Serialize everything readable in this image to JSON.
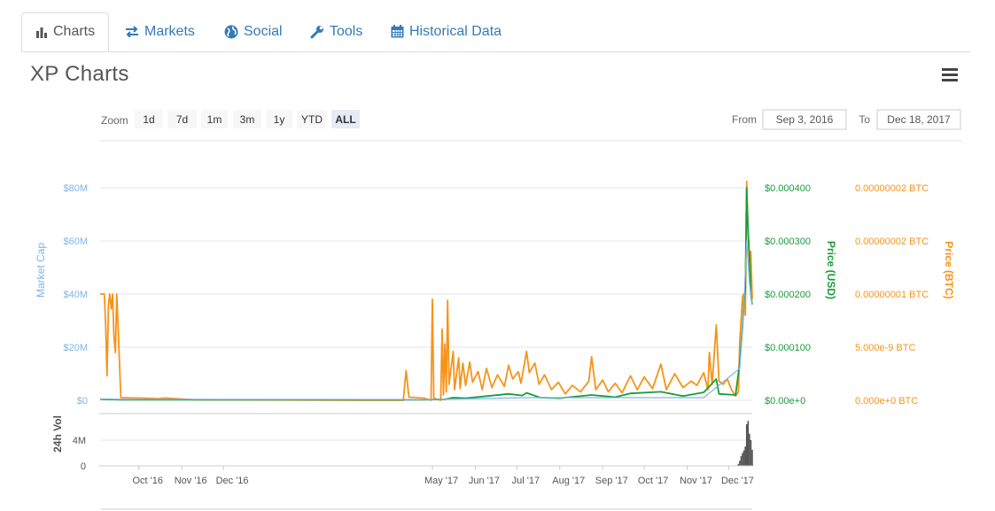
{
  "tabs": [
    {
      "label": "Charts",
      "icon": "bar-chart-icon",
      "active": true
    },
    {
      "label": "Markets",
      "icon": "exchange-arrows-icon",
      "active": false
    },
    {
      "label": "Social",
      "icon": "globe-icon",
      "active": false
    },
    {
      "label": "Tools",
      "icon": "wrench-icon",
      "active": false
    },
    {
      "label": "Historical Data",
      "icon": "calendar-icon",
      "active": false
    }
  ],
  "page_title": "XP Charts",
  "menu_icon": "hamburger-menu-icon",
  "zoom": {
    "label": "Zoom",
    "buttons": [
      "1d",
      "7d",
      "1m",
      "3m",
      "1y",
      "YTD",
      "ALL"
    ],
    "selected": "ALL"
  },
  "range": {
    "from_label": "From",
    "from_value": "Sep 3, 2016",
    "to_label": "To",
    "to_value": "Dec 18, 2017"
  },
  "colors": {
    "market_cap": "#7cb5ec",
    "price_usd": "#1a9c3a",
    "price_btc": "#f7931a",
    "volume": "#555555",
    "accent": "#337ab7",
    "grid": "#e6e6e6"
  },
  "chart_data": {
    "type": "line",
    "x_axis": {
      "min": "2016-09-03",
      "max": "2017-12-18",
      "ticks": [
        "Oct '16",
        "Nov '16",
        "Dec '16",
        "May '17",
        "Jun '17",
        "Jul '17",
        "Aug '17",
        "Sep '17",
        "Oct '17",
        "Nov '17",
        "Dec '17"
      ]
    },
    "grid": true,
    "axes": {
      "market_cap": {
        "label": "Market Cap",
        "ticks": [
          "$0",
          "$20M",
          "$40M",
          "$60M",
          "$80M"
        ],
        "range": [
          0,
          80000000
        ]
      },
      "price_usd": {
        "label": "Price (USD)",
        "ticks": [
          "$0.00e+0",
          "$0.000100",
          "$0.000200",
          "$0.000300",
          "$0.000400"
        ],
        "range": [
          0,
          0.0004
        ]
      },
      "price_btc": {
        "label": "Price (BTC)",
        "ticks": [
          "0.000e+0 BTC",
          "5.000e-9 BTC",
          "0.00000001 BTC",
          "0.00000002 BTC",
          "0.00000002 BTC"
        ],
        "range": [
          0,
          2e-08
        ]
      },
      "volume": {
        "label": "24h Vol",
        "ticks": [
          "0",
          "4M"
        ],
        "range": [
          0,
          8000000
        ]
      }
    },
    "series": [
      {
        "name": "Price (BTC)",
        "axis": "price_btc",
        "points": [
          [
            "2016-09-03",
            1e-08
          ],
          [
            "2016-09-06",
            1e-08
          ],
          [
            "2016-09-07",
            7e-09
          ],
          [
            "2016-09-08",
            2.3e-09
          ],
          [
            "2016-09-09",
            9e-09
          ],
          [
            "2016-09-10",
            1e-08
          ],
          [
            "2016-09-11",
            8.6e-09
          ],
          [
            "2016-09-12",
            1e-08
          ],
          [
            "2016-09-13",
            6e-09
          ],
          [
            "2016-09-14",
            4.5e-09
          ],
          [
            "2016-09-15",
            1e-08
          ],
          [
            "2016-09-18",
            2.5e-10
          ],
          [
            "2016-10-06",
            2e-10
          ],
          [
            "2016-10-15",
            1.5e-10
          ],
          [
            "2016-10-20",
            2.2e-10
          ],
          [
            "2016-11-10",
            5e-11
          ],
          [
            "2017-03-20",
            0
          ],
          [
            "2017-04-10",
            0
          ],
          [
            "2017-04-12",
            2.8e-09
          ],
          [
            "2017-04-14",
            3e-10
          ],
          [
            "2017-04-25",
            2e-10
          ],
          [
            "2017-04-30",
            0
          ],
          [
            "2017-05-01",
            9.5e-09
          ],
          [
            "2017-05-02",
            2e-10
          ],
          [
            "2017-05-07",
            0
          ],
          [
            "2017-05-08",
            6.7e-09
          ],
          [
            "2017-05-09",
            5e-10
          ],
          [
            "2017-05-10",
            5.3e-09
          ],
          [
            "2017-05-11",
            8e-10
          ],
          [
            "2017-05-12",
            9.4e-09
          ],
          [
            "2017-05-13",
            1.5e-09
          ],
          [
            "2017-05-16",
            4.6e-09
          ],
          [
            "2017-05-17",
            1e-09
          ],
          [
            "2017-05-20",
            4e-09
          ],
          [
            "2017-05-21",
            1.1e-09
          ],
          [
            "2017-05-23",
            3.5e-09
          ],
          [
            "2017-05-25",
            1.4e-09
          ],
          [
            "2017-05-28",
            3.6e-09
          ],
          [
            "2017-05-30",
            1.7e-09
          ],
          [
            "2017-06-03",
            2.7e-09
          ],
          [
            "2017-06-06",
            1e-09
          ],
          [
            "2017-06-09",
            3e-09
          ],
          [
            "2017-06-13",
            1.2e-09
          ],
          [
            "2017-06-17",
            2.4e-09
          ],
          [
            "2017-06-22",
            1.3e-09
          ],
          [
            "2017-06-25",
            3.3e-09
          ],
          [
            "2017-06-28",
            2e-09
          ],
          [
            "2017-07-02",
            2.7e-09
          ],
          [
            "2017-07-04",
            1.6e-09
          ],
          [
            "2017-07-08",
            4.6e-09
          ],
          [
            "2017-07-10",
            2.6e-09
          ],
          [
            "2017-07-14",
            3.5e-09
          ],
          [
            "2017-07-17",
            1.5e-09
          ],
          [
            "2017-07-21",
            2.4e-09
          ],
          [
            "2017-07-26",
            1e-09
          ],
          [
            "2017-07-31",
            1.7e-09
          ],
          [
            "2017-08-05",
            6e-10
          ],
          [
            "2017-08-10",
            1.4e-09
          ],
          [
            "2017-08-16",
            8e-10
          ],
          [
            "2017-08-22",
            1.8e-09
          ],
          [
            "2017-08-24",
            4.1e-09
          ],
          [
            "2017-08-27",
            1e-09
          ],
          [
            "2017-09-01",
            1.9e-09
          ],
          [
            "2017-09-05",
            8e-10
          ],
          [
            "2017-09-10",
            1.6e-09
          ],
          [
            "2017-09-15",
            7e-10
          ],
          [
            "2017-09-21",
            2.3e-09
          ],
          [
            "2017-09-26",
            1e-09
          ],
          [
            "2017-10-01",
            2.2e-09
          ],
          [
            "2017-10-07",
            1.1e-09
          ],
          [
            "2017-10-13",
            3.4e-09
          ],
          [
            "2017-10-17",
            1e-09
          ],
          [
            "2017-10-23",
            2.5e-09
          ],
          [
            "2017-10-29",
            1.2e-09
          ],
          [
            "2017-11-04",
            1.8e-09
          ],
          [
            "2017-11-08",
            1.4e-09
          ],
          [
            "2017-11-13",
            2.6e-09
          ],
          [
            "2017-11-16",
            1e-09
          ],
          [
            "2017-11-17",
            4.5e-09
          ],
          [
            "2017-11-19",
            1.5e-09
          ],
          [
            "2017-11-22",
            7.1e-09
          ],
          [
            "2017-11-24",
            1.8e-09
          ],
          [
            "2017-11-27",
            1.5e-09
          ],
          [
            "2017-11-30",
            2e-09
          ],
          [
            "2017-12-03",
            1e-09
          ],
          [
            "2017-12-06",
            4e-10
          ],
          [
            "2017-12-08",
            8e-10
          ],
          [
            "2017-12-09",
            5.5e-09
          ],
          [
            "2017-12-11",
            9.8e-09
          ],
          [
            "2017-12-12",
            1e-08
          ],
          [
            "2017-12-13",
            8e-09
          ],
          [
            "2017-12-14",
            2.06e-08
          ],
          [
            "2017-12-15",
            1.55e-08
          ],
          [
            "2017-12-16",
            1.3e-08
          ],
          [
            "2017-12-17",
            1.4e-08
          ],
          [
            "2017-12-18",
            9.5e-09
          ]
        ]
      },
      {
        "name": "Price (USD)",
        "axis": "price_usd",
        "points": [
          [
            "2016-09-03",
            2e-06
          ],
          [
            "2016-09-18",
            1e-06
          ],
          [
            "2017-04-25",
            1e-06
          ],
          [
            "2017-05-10",
            1.8e-06
          ],
          [
            "2017-05-16",
            5e-06
          ],
          [
            "2017-05-25",
            4e-06
          ],
          [
            "2017-06-10",
            8e-06
          ],
          [
            "2017-06-25",
            1.2e-05
          ],
          [
            "2017-07-05",
            9e-06
          ],
          [
            "2017-07-08",
            1.4e-05
          ],
          [
            "2017-07-18",
            5e-06
          ],
          [
            "2017-08-01",
            4e-06
          ],
          [
            "2017-08-24",
            1e-05
          ],
          [
            "2017-09-10",
            6e-06
          ],
          [
            "2017-09-21",
            1.3e-05
          ],
          [
            "2017-10-13",
            1.6e-05
          ],
          [
            "2017-10-29",
            8e-06
          ],
          [
            "2017-11-13",
            1.5e-05
          ],
          [
            "2017-11-22",
            4e-05
          ],
          [
            "2017-11-24",
            1.2e-05
          ],
          [
            "2017-12-06",
            1e-05
          ],
          [
            "2017-12-09",
            7e-05
          ],
          [
            "2017-12-11",
            0.00014
          ],
          [
            "2017-12-12",
            0.000185
          ],
          [
            "2017-12-13",
            0.00021
          ],
          [
            "2017-12-14",
            0.0004
          ],
          [
            "2017-12-15",
            0.00032
          ],
          [
            "2017-12-16",
            0.00027
          ],
          [
            "2017-12-17",
            0.0002
          ],
          [
            "2017-12-18",
            0.00018
          ]
        ]
      },
      {
        "name": "Market Cap",
        "axis": "market_cap",
        "points": [
          [
            "2016-09-03",
            400000
          ],
          [
            "2017-05-01",
            300000
          ],
          [
            "2017-07-10",
            1000000
          ],
          [
            "2017-09-21",
            1000000
          ],
          [
            "2017-11-13",
            1000000
          ],
          [
            "2017-12-09",
            12000000
          ],
          [
            "2017-12-12",
            36000000
          ],
          [
            "2017-12-14",
            60000000
          ],
          [
            "2017-12-15",
            52000000
          ],
          [
            "2017-12-16",
            44000000
          ],
          [
            "2017-12-17",
            40000000
          ],
          [
            "2017-12-18",
            36000000
          ]
        ]
      }
    ],
    "volume": [
      [
        "2017-12-08",
        300000
      ],
      [
        "2017-12-09",
        800000
      ],
      [
        "2017-12-10",
        1500000
      ],
      [
        "2017-12-11",
        2000000
      ],
      [
        "2017-12-12",
        2400000
      ],
      [
        "2017-12-13",
        3000000
      ],
      [
        "2017-12-14",
        6500000
      ],
      [
        "2017-12-15",
        7000000
      ],
      [
        "2017-12-16",
        5000000
      ],
      [
        "2017-12-17",
        4000000
      ],
      [
        "2017-12-18",
        2500000
      ]
    ]
  }
}
